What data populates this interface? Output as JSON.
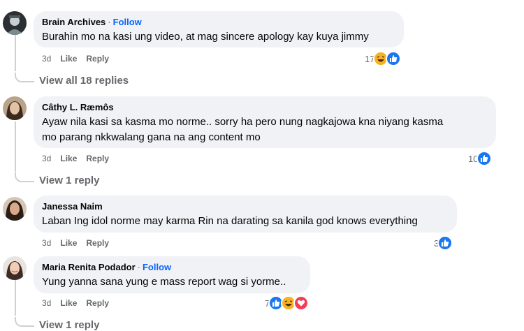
{
  "comments": [
    {
      "author": "Brain Archives",
      "follow": "Follow",
      "text_lines": [
        "Burahin mo na kasi ung video, at mag sincere apology kay kuya jimmy"
      ],
      "time": "3d",
      "like": "Like",
      "reply": "Reply",
      "reaction_count": "17",
      "reactions": [
        "haha-icon",
        "like-icon"
      ],
      "view_replies": "View all 18 replies"
    },
    {
      "author": "Câthy L. Ræmôs",
      "follow": "",
      "text_lines": [
        "Ayaw nila kasi sa kasma mo norme.. sorry ha pero nung nagkajowa kna niyang kasma",
        "mo parang nkkwalang gana na ang content mo"
      ],
      "time": "3d",
      "like": "Like",
      "reply": "Reply",
      "reaction_count": "10",
      "reactions": [
        "like-icon"
      ],
      "view_replies": "View 1 reply"
    },
    {
      "author": "Janessa Naim",
      "follow": "",
      "text_lines": [
        "Laban Ing idol norme may karma Rin na darating sa kanila god knows everything"
      ],
      "time": "3d",
      "like": "Like",
      "reply": "Reply",
      "reaction_count": "3",
      "reactions": [
        "like-icon"
      ],
      "view_replies": ""
    },
    {
      "author": "Maria Renita Podador",
      "follow": "Follow",
      "text_lines": [
        "Yung yanna sana yung e mass report wag si yorme.."
      ],
      "time": "3d",
      "like": "Like",
      "reply": "Reply",
      "reaction_count": "7",
      "reactions": [
        "like-icon",
        "haha-icon",
        "love-icon"
      ],
      "view_replies": "View 1 reply"
    }
  ],
  "colors": {
    "bubble": "#f0f2f5",
    "follow": "#0866ff",
    "like": "#1877f2",
    "haha": "#f7b125",
    "love": "#f33e58",
    "meta": "#65676b"
  }
}
